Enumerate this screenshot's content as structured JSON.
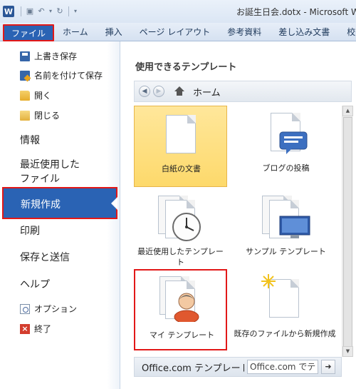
{
  "window": {
    "title": "お誕生日会.dotx - Microsoft Wo",
    "app_icon_letter": "W"
  },
  "ribbon": {
    "tabs": [
      {
        "label": "ファイル",
        "active": true
      },
      {
        "label": "ホーム"
      },
      {
        "label": "挿入"
      },
      {
        "label": "ページ レイアウト"
      },
      {
        "label": "参考資料"
      },
      {
        "label": "差し込み文書"
      },
      {
        "label": "校閲"
      }
    ]
  },
  "backstage": {
    "commands": {
      "save": "上書き保存",
      "save_as": "名前を付けて保存",
      "open": "開く",
      "close": "閉じる"
    },
    "sections": {
      "info": "情報",
      "recent": "最近使用した\nファイル",
      "new": "新規作成",
      "print": "印刷",
      "save_send": "保存と送信",
      "help": "ヘルプ"
    },
    "bottom": {
      "options": "オプション",
      "exit": "終了"
    }
  },
  "templates": {
    "heading": "使用できるテンプレート",
    "nav_location": "ホーム",
    "tiles": {
      "blank": "白紙の文書",
      "blog": "ブログの投稿",
      "recent": "最近使用したテンプレート",
      "sample": "サンプル テンプレート",
      "mine": "マイ テンプレート",
      "from_existing": "既存のファイルから新規作成"
    },
    "office_label": "Office.com テンプレート",
    "office_search_placeholder": "Office.com でテンプレートを検索"
  },
  "colors": {
    "file_tab": "#2a63b4",
    "highlight_border": "#e21818",
    "selected_tile": "#fdd96b"
  }
}
